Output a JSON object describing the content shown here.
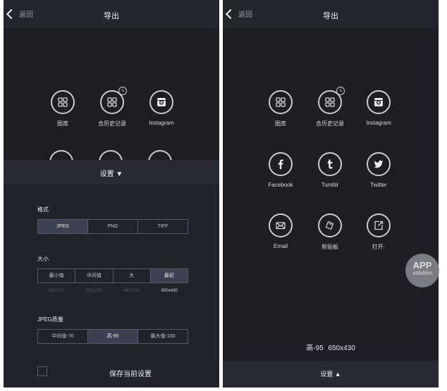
{
  "left": {
    "nav": {
      "back_label": "返回",
      "title": "导出"
    },
    "icons": [
      {
        "label": "图库",
        "icon": "grid-icon"
      },
      {
        "label": "含历史记录",
        "icon": "grid-history-icon"
      },
      {
        "label": "Instagram",
        "icon": "instagram-icon"
      }
    ],
    "settings": {
      "header": "设置 ▼",
      "format": {
        "label": "格式",
        "options": [
          "JPEG",
          "PNG",
          "TIFF"
        ],
        "selected": "JPEG"
      },
      "size": {
        "label": "大小",
        "options": [
          "最小值",
          "中间值",
          "大",
          "最初"
        ],
        "dims": [
          "162x107",
          "325x215",
          "487x322",
          "650x430"
        ],
        "selected": "最初"
      },
      "quality": {
        "label": "JPEG质量",
        "options": [
          "中间值-70",
          "高-95",
          "最大值-100"
        ],
        "selected": "高-95"
      },
      "save_label": "保存当前设置"
    }
  },
  "right": {
    "nav": {
      "back_label": "返回",
      "title": "导出"
    },
    "icons": [
      {
        "label": "图库",
        "icon": "grid-icon"
      },
      {
        "label": "含历史记录",
        "icon": "grid-history-icon"
      },
      {
        "label": "Instagram",
        "icon": "instagram-icon"
      },
      {
        "label": "Facebook",
        "icon": "facebook-icon"
      },
      {
        "label": "Tumblr",
        "icon": "tumblr-icon"
      },
      {
        "label": "Twitter",
        "icon": "twitter-icon"
      },
      {
        "label": "Email",
        "icon": "email-icon"
      },
      {
        "label": "剪贴板",
        "icon": "clipboard-icon"
      },
      {
        "label": "打开·",
        "icon": "open-in-icon"
      }
    ],
    "summary": "高-95 650x430",
    "settings_toggle": "设置 ▲"
  },
  "watermark": {
    "line1": "APP",
    "line2": "solution"
  }
}
